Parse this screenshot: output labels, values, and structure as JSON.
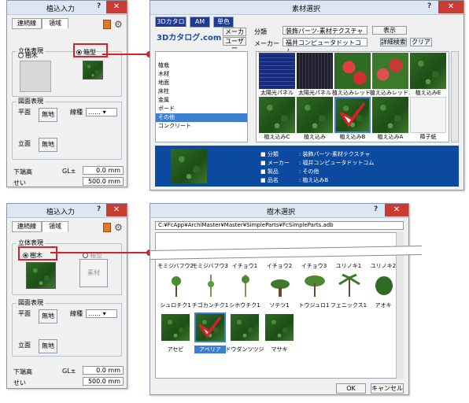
{
  "dialog1": {
    "title": "植込入力",
    "question": "?",
    "close": "✕",
    "tabs": [
      "連続線",
      "領域"
    ],
    "group_3d": "立体表現",
    "radio_tree": "樹木",
    "radio_box": "箱型",
    "group_plan": "図面表現",
    "plan_label": "平面",
    "no_fill": "無地",
    "line_type_label": "線種",
    "elev_label": "立面",
    "no_fill2": "無地",
    "ground_label": "下端高",
    "gl_label": "GL±",
    "gl_value": "0.0 mm",
    "height_label": "せい",
    "height_value": "500.0 mm"
  },
  "dialog2": {
    "title": "植込入力",
    "question": "?",
    "close": "✕",
    "tabs": [
      "連続線",
      "領域"
    ],
    "group_3d": "立体表現",
    "radio_tree": "樹木",
    "radio_box": "箱型",
    "material_button": "素材",
    "group_plan": "図面表現",
    "plan_label": "平面",
    "no_fill": "無地",
    "line_type_label": "線種",
    "elev_label": "立面",
    "no_fill2": "無地",
    "ground_label": "下端高",
    "gl_label": "GL±",
    "gl_value": "0.0 mm",
    "height_label": "せい",
    "height_value": "500.0 mm"
  },
  "material": {
    "title": "素材選択",
    "question": "?",
    "close": "✕",
    "tabs": [
      "3Dカタログ",
      "AM",
      "単色"
    ],
    "logo": "3Dカタログ.com",
    "maker_btn": "メーカー",
    "user_btn": "ユーザー",
    "category_label": "分類",
    "category_value": "装飾パーツ-素材テクスチャ",
    "display_label": "表示",
    "maker_label": "メーカー",
    "maker_value": "福井コンピュータドットコム",
    "detail_search": "詳細検索",
    "clear": "クリア",
    "list": [
      "",
      "",
      "",
      "",
      "",
      "",
      "",
      "",
      "",
      "",
      "",
      "",
      "",
      "",
      ""
    ],
    "list_items": [
      "",
      "",
      "",
      "",
      "",
      "",
      "",
      "",
      "",
      "",
      ""
    ],
    "categories": [
      "",
      "",
      "",
      "",
      "",
      "",
      "",
      "",
      ""
    ],
    "category_items": [
      "",
      "",
      "",
      "",
      "",
      ""
    ],
    "category_names": [
      "",
      "",
      "",
      "",
      "",
      "",
      "",
      "",
      "",
      ""
    ],
    "sidebar": [
      "",
      "",
      "",
      "",
      "",
      "",
      ""
    ],
    "side_items": [
      "植栽",
      "木材",
      "地面",
      "床柱",
      "金属",
      "ボード",
      "その他",
      "コンクリート"
    ],
    "selected_item": "その他",
    "thumbs": [
      "太陽光パネル",
      "太陽光パネル",
      "植え込みレッド...",
      "植え込みレッド...",
      "植え込みE",
      "植え込みC",
      "植え込み",
      "植え込みB",
      "植え込みA",
      "障子紙"
    ],
    "info": [
      {
        "k": "分類",
        "v": "装飾パーツ-素材テクスチャ"
      },
      {
        "k": "メーカー",
        "v": "福井コンピュータドットコム"
      },
      {
        "k": "製品",
        "v": "その他"
      },
      {
        "k": "品名",
        "v": "植え込みB"
      }
    ],
    "info_sep": ":"
  },
  "tree": {
    "title": "樹木選択",
    "question": "?",
    "close": "✕",
    "path": "C:¥FcApp¥ArchiMaster¥Master¥SimpleParts¥FcSimpleParts.adb",
    "row1": [
      "モミジバフウ2",
      "モミジバフウ3",
      "イチョウ1",
      "イチョウ2",
      "イチョウ3",
      "ユリノキ1",
      "ユリノキ2"
    ],
    "row2": [
      "シュロチク1",
      "チゴカンチク1",
      "シホウチク1",
      "ソテツ1",
      "トウジュロ1",
      "フェニックス1",
      "アオキ"
    ],
    "row3": [
      "アセビ",
      "アベリア",
      "ドウダンツツジ",
      "マサキ"
    ],
    "ok": "OK",
    "cancel": "キャンセル"
  }
}
